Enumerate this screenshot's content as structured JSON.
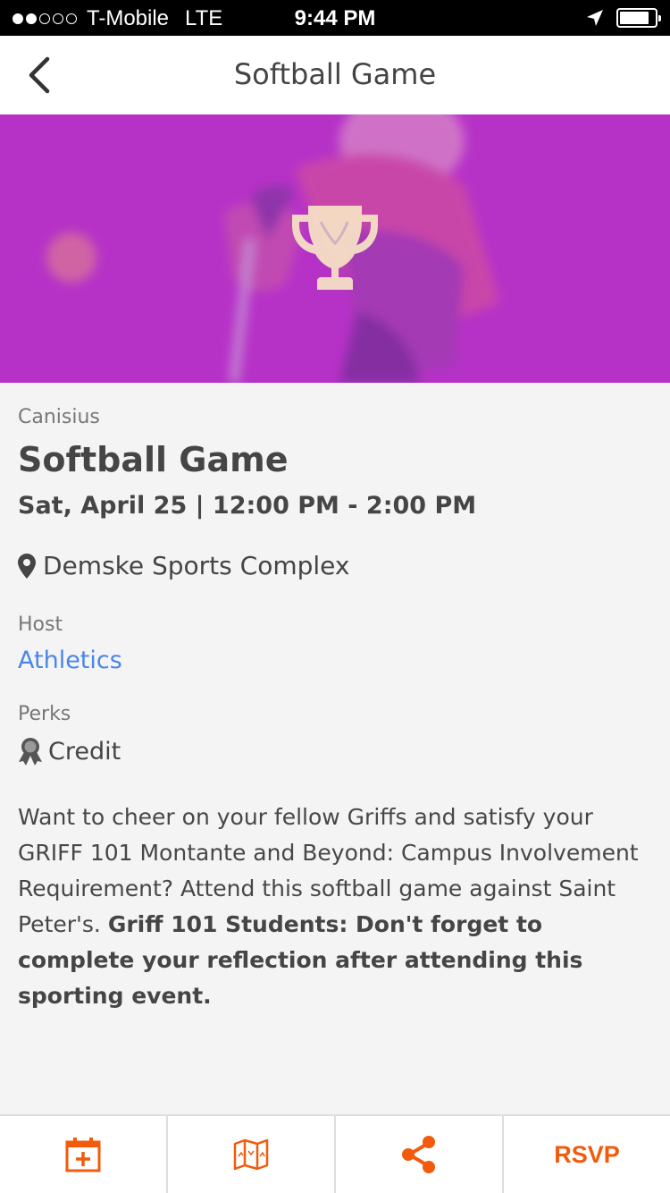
{
  "status_bar": {
    "carrier": "T-Mobile",
    "network": "LTE",
    "time": "9:44 PM",
    "signal_bars_filled": 2,
    "signal_bars_total": 5,
    "battery_level": 0.85
  },
  "nav": {
    "title": "Softball Game",
    "back_icon": "chevron-left-icon"
  },
  "hero": {
    "icon": "trophy-icon",
    "tint_color": "#b531c6"
  },
  "event": {
    "organization": "Canisius",
    "title": "Softball Game",
    "datetime": "Sat, April 25 | 12:00 PM - 2:00 PM",
    "location": "Demske Sports Complex",
    "host_label": "Host",
    "host": "Athletics",
    "perks_label": "Perks",
    "perk": "Credit",
    "description_plain": "Want to cheer on your fellow Griffs and satisfy your GRIFF 101 Montante and Beyond: Campus Involvement Requirement? Attend this softball game against Saint Peter's. ",
    "description_bold": "Griff 101 Students: Don't forget to complete your reflection after attending this sporting event."
  },
  "toolbar": {
    "calendar_icon": "calendar-add-icon",
    "map_icon": "map-icon",
    "share_icon": "share-icon",
    "rsvp_label": "RSVP",
    "accent_color": "#f25a0c"
  },
  "colors": {
    "link": "#4a86e8",
    "background": "#f4f4f4"
  }
}
